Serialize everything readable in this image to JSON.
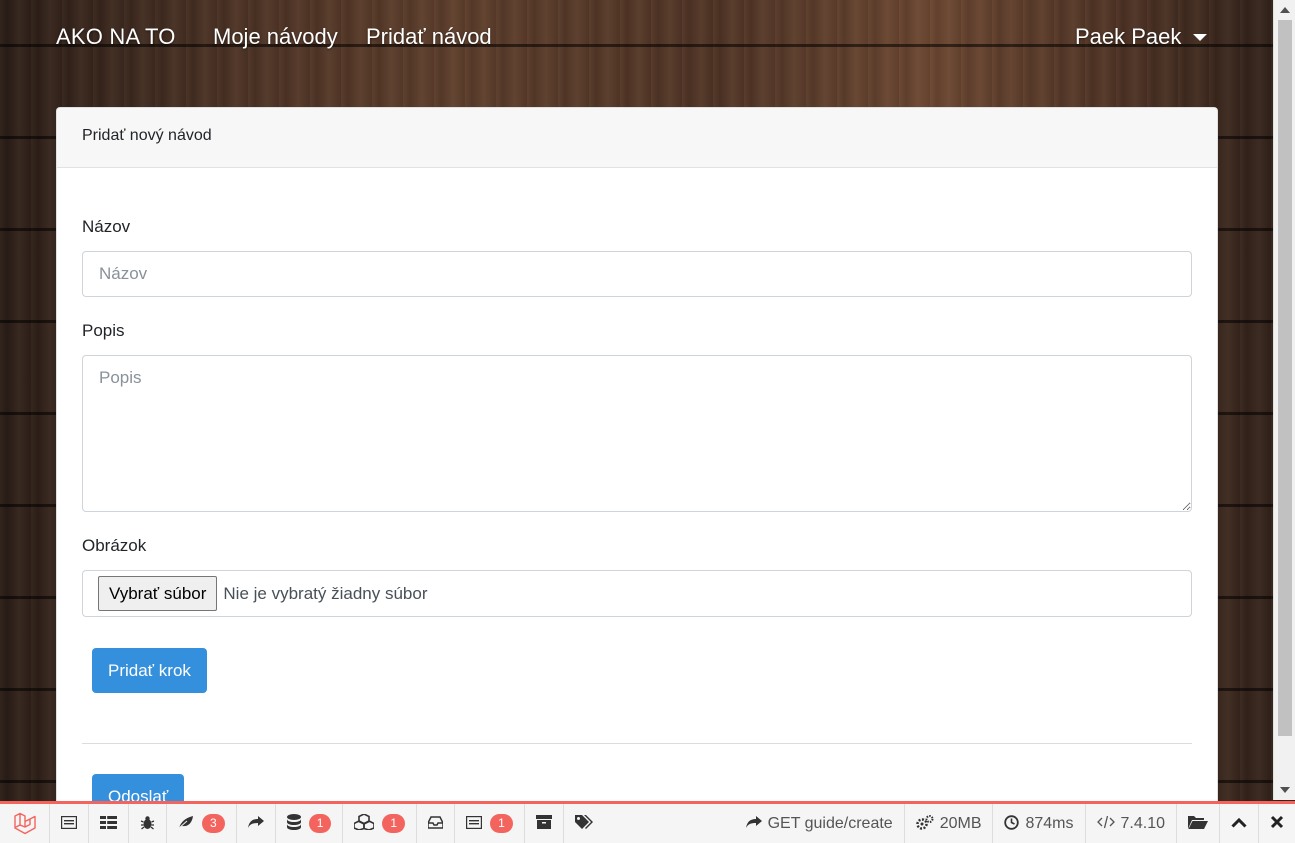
{
  "navbar": {
    "brand": "AKO NA TO",
    "links": [
      "Moje návody",
      "Pridať návod"
    ],
    "user_name": "Paek Paek"
  },
  "card": {
    "header": "Pridať nový návod",
    "fields": {
      "title_label": "Názov",
      "title_placeholder": "Názov",
      "description_label": "Popis",
      "description_placeholder": "Popis",
      "image_label": "Obrázok",
      "file_button": "Vybrať súbor",
      "file_status": "Nie je vybratý žiadny súbor"
    },
    "add_step_button": "Pridať krok",
    "submit_button": "Odoslať"
  },
  "debugbar": {
    "accent": "#f4645f",
    "items": [
      {
        "icon": "messages-icon",
        "count": ""
      },
      {
        "icon": "timeline-icon",
        "count": ""
      },
      {
        "icon": "exceptions-icon",
        "count": ""
      },
      {
        "icon": "views-icon",
        "count": "3"
      },
      {
        "icon": "route-icon",
        "count": ""
      },
      {
        "icon": "queries-icon",
        "count": "1"
      },
      {
        "icon": "models-icon",
        "count": "1"
      },
      {
        "icon": "mail-icon",
        "count": ""
      },
      {
        "icon": "gate-icon",
        "count": "1"
      },
      {
        "icon": "session-icon",
        "count": ""
      },
      {
        "icon": "request-icon",
        "count": ""
      }
    ],
    "route": "GET guide/create",
    "memory": "20MB",
    "time": "874ms",
    "php_version": "7.4.10"
  }
}
